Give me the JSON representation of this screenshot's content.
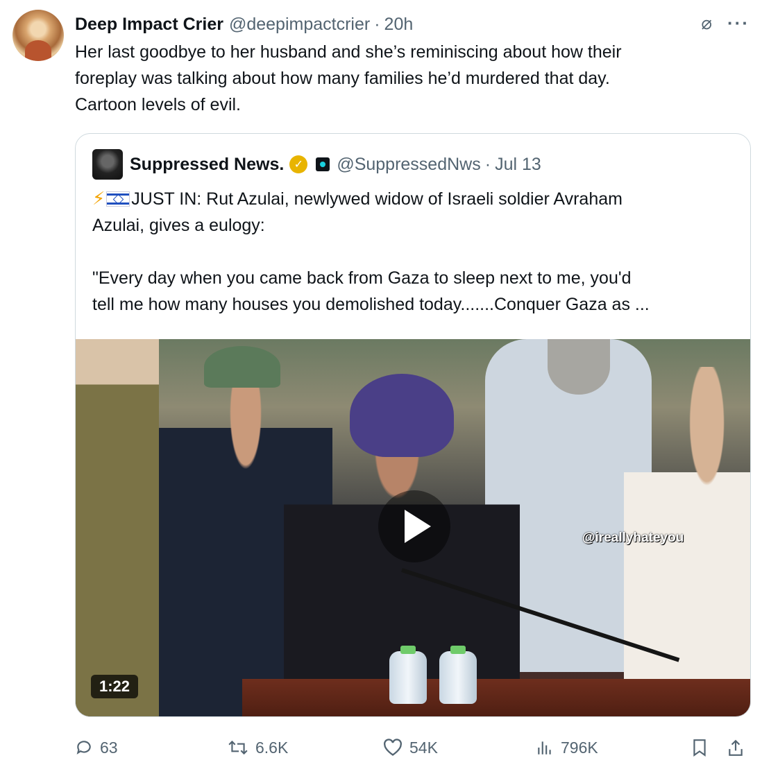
{
  "tweet": {
    "author_name": "Deep Impact Crier",
    "author_handle": "@deepimpactcrier",
    "separator": "·",
    "time": "20h",
    "text": "Her last goodbye to her husband and she’s reminiscing about how their\nforeplay was talking about how many families he’d murdered that day.\nCartoon levels of evil."
  },
  "quote": {
    "author_name": "Suppressed News.",
    "author_handle": "@SuppressedNws",
    "separator": "·",
    "time": "Jul 13",
    "text_lead": "JUST IN: Rut Azulai, newlywed widow of  Israeli soldier Avraham\nAzulai, gives a eulogy:\n\n\"Every day when you came back from Gaza to sleep next to me, you'd\ntell me how many houses you demolished today.......Conquer Gaza as ...",
    "video": {
      "watermark": "@ireallyhateyou",
      "duration": "1:22"
    }
  },
  "actions": {
    "replies": "63",
    "reposts": "6.6K",
    "likes": "54K",
    "views": "796K"
  },
  "icons": {
    "grok": "grok-icon",
    "more": "more-icon",
    "verified": "gold-verified-icon",
    "affiliate": "affiliate-badge-icon",
    "reply": "reply-icon",
    "repost": "repost-icon",
    "like": "heart-icon",
    "views": "views-icon",
    "bookmark": "bookmark-icon",
    "share": "share-icon"
  },
  "colors": {
    "text_primary": "#0f1419",
    "text_secondary": "#536471",
    "border": "#cfd9de",
    "verified_gold": "#e8b400"
  }
}
